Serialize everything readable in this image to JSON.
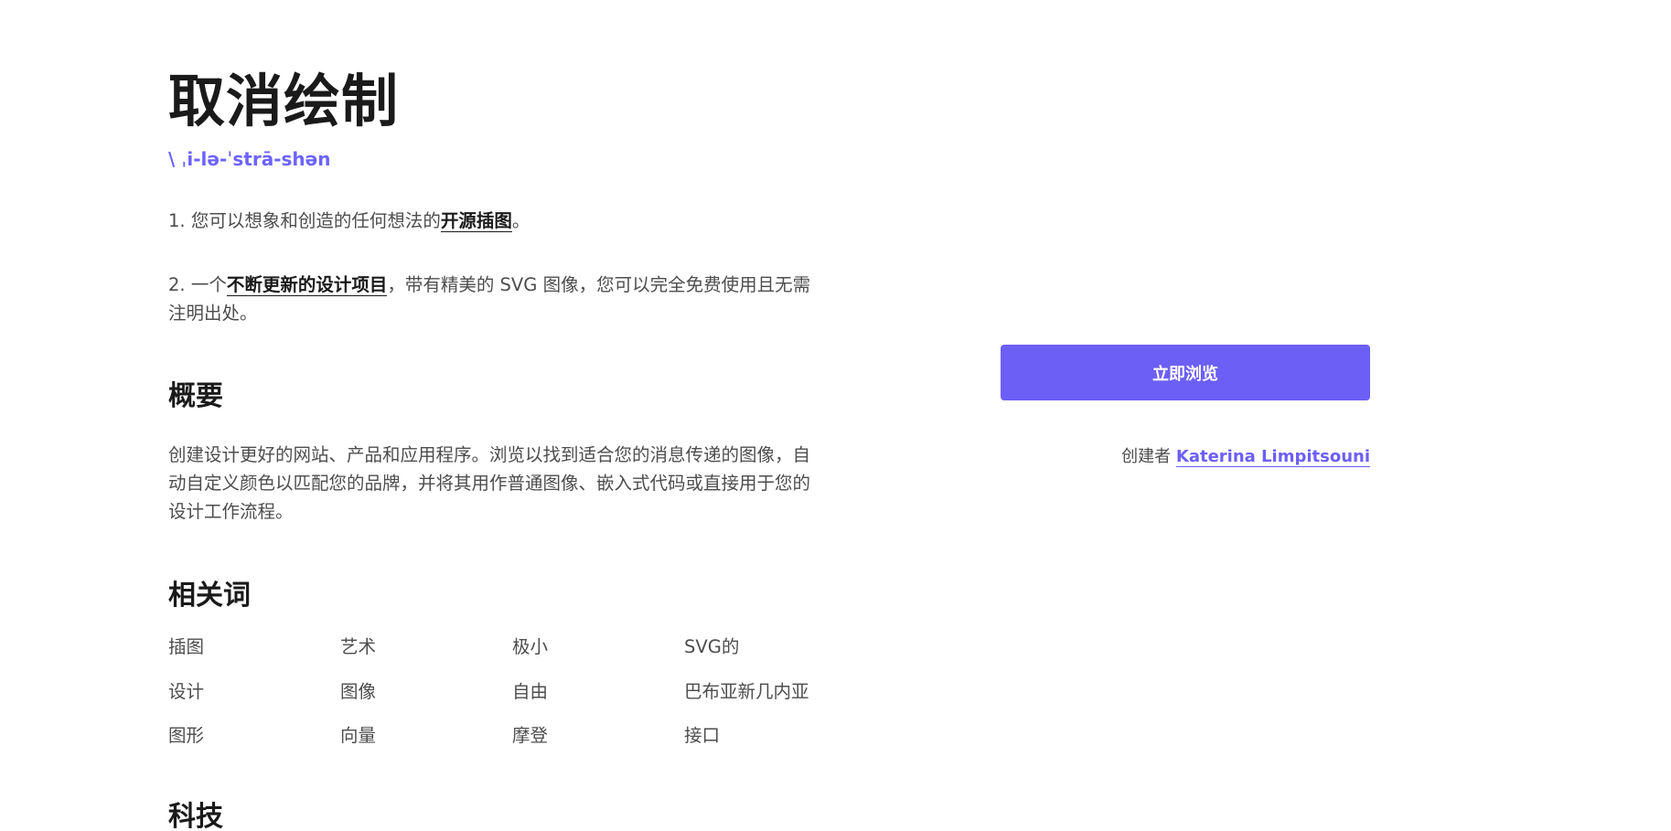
{
  "title": "取消绘制",
  "pronunciation": "\\ ˌi-lə-ˈstrā-shən",
  "definitions": [
    {
      "number": "1.",
      "before": "您可以想象和创造的任何想法的",
      "link": "开源插图",
      "after": "。"
    },
    {
      "number": "2.",
      "before": "一个",
      "link": "不断更新的设计项目",
      "after": "，带有精美的 SVG 图像，您可以完全免费使用且无需注明出处。"
    }
  ],
  "overview": {
    "heading": "概要",
    "text": "创建设计更好的网站、产品和应用程序。浏览以找到适合您的消息传递的图像，自动自定义颜色以匹配您的品牌，并将其用作普通图像、嵌入式代码或直接用于您的设计工作流程。"
  },
  "related": {
    "heading": "相关词",
    "words": [
      "插图",
      "艺术",
      "极小",
      "SVG的",
      "设计",
      "图像",
      "自由",
      "巴布亚新几内亚",
      "图形",
      "向量",
      "摩登",
      "接口"
    ]
  },
  "tech": {
    "heading": "科技"
  },
  "browse_button": "立即浏览",
  "creator": {
    "label": "创建者",
    "name": "Katerina Limpitsouni"
  },
  "colors": {
    "accent": "#6c5ff5",
    "heading": "#1a1a1a",
    "body_text": "#4d4d4d",
    "background": "#ffffff"
  }
}
